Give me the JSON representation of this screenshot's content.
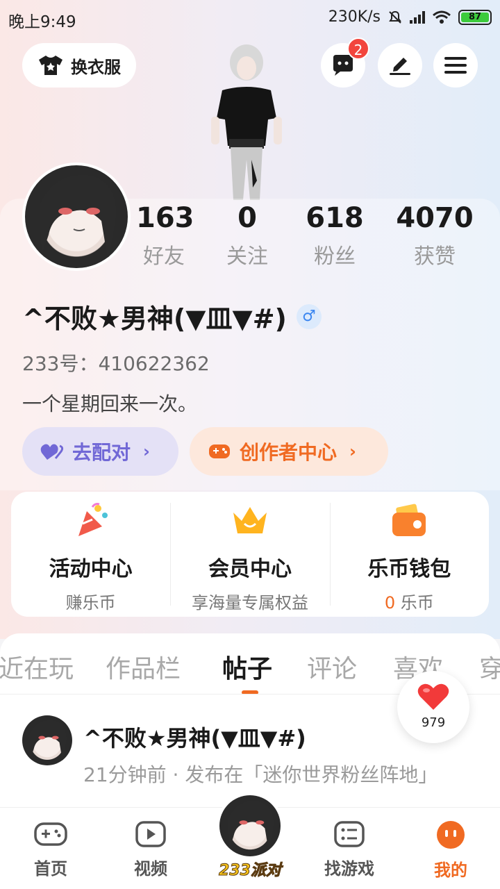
{
  "status_bar": {
    "time": "晚上9:49",
    "speed": "230K/s",
    "battery": "87"
  },
  "header": {
    "dress_label": "换衣服",
    "message_badge": "2",
    "icons": [
      "shirt-icon",
      "chat-icon",
      "edit-icon",
      "menu-icon"
    ]
  },
  "profile": {
    "stats": [
      {
        "num": "163",
        "label": "好友"
      },
      {
        "num": "0",
        "label": "关注"
      },
      {
        "num": "618",
        "label": "粉丝"
      },
      {
        "num": "4070",
        "label": "获赞"
      }
    ],
    "username": "^不败★男神(▼皿▼#)",
    "gender_symbol": "♂",
    "uid": "233号：410622362",
    "bio": "一个星期回来一次。",
    "match_label": "去配对",
    "creator_label": "创作者中心"
  },
  "services": [
    {
      "title": "活动中心",
      "sub": "赚乐币"
    },
    {
      "title": "会员中心",
      "sub": "享海量专属权益"
    },
    {
      "title": "乐币钱包",
      "num": "0",
      "sub": "乐币"
    }
  ],
  "tabs": [
    "近在玩",
    "作品栏",
    "帖子",
    "评论",
    "喜欢",
    "穿"
  ],
  "active_tab": "帖子",
  "post": {
    "author": "^不败★男神(▼皿▼#)",
    "meta": "21分钟前 · 发布在「迷你世界粉丝阵地」"
  },
  "like_count": "979",
  "bottom_nav": {
    "home": "首页",
    "video": "视频",
    "center": "233派对",
    "find": "找游戏",
    "mine": "我的"
  },
  "colors": {
    "accent": "#f06a22",
    "match": "#7168d6",
    "badge": "#f2453d"
  }
}
